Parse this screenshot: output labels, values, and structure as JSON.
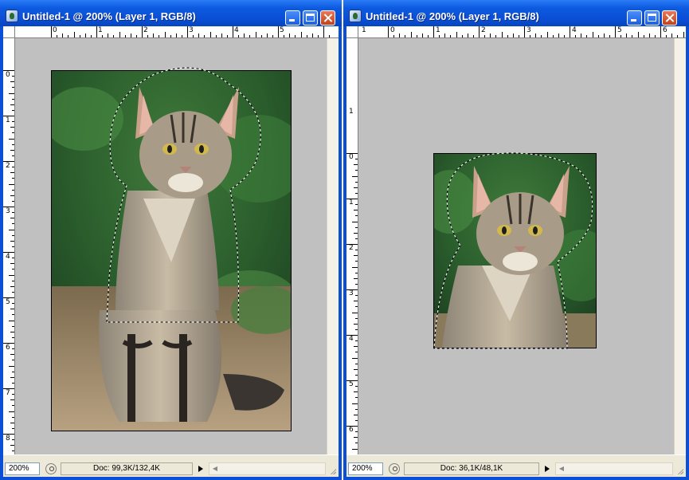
{
  "windows": [
    {
      "title": "Untitled-1 @ 200% (Layer 1, RGB/8)",
      "zoom": "200%",
      "doc_info": "Doc: 99,3K/132,4K",
      "ruler_top_numbers": [
        "0",
        "1",
        "2",
        "3",
        "4",
        "5"
      ],
      "ruler_left_numbers": [
        "0",
        "1",
        "2",
        "3",
        "4",
        "5",
        "6",
        "7",
        "8"
      ]
    },
    {
      "title": "Untitled-1 @ 200% (Layer 1, RGB/8)",
      "zoom": "200%",
      "doc_info": "Doc: 36,1K/48,1K",
      "ruler_top_numbers": [
        "1",
        "0",
        "1",
        "2",
        "3",
        "4",
        "5",
        "6"
      ],
      "ruler_left_numbers": [
        "1",
        "0",
        "1",
        "2",
        "3",
        "4",
        "5",
        "6"
      ]
    }
  ],
  "icons": {
    "app": "photoshop-document-icon",
    "minimize": "minimize-icon",
    "maximize": "maximize-icon",
    "close": "close-icon",
    "status": "status-menu-icon",
    "arrow": "triangle-right-icon"
  },
  "colors": {
    "titlebar": "#0a4fd6",
    "canvas_bg": "#c0c0c0",
    "close_button": "#c3421a"
  }
}
